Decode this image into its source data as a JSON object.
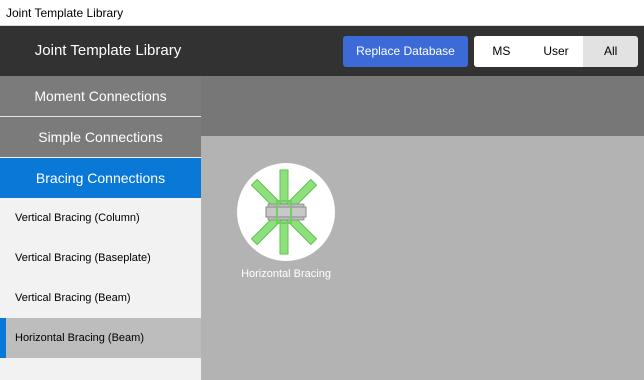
{
  "window": {
    "title": "Joint Template Library"
  },
  "header": {
    "title": "Joint Template Library",
    "replace_button": "Replace Database",
    "filters": [
      {
        "label": "MS",
        "active": false
      },
      {
        "label": "User",
        "active": false
      },
      {
        "label": "All",
        "active": true
      }
    ]
  },
  "sidebar": {
    "categories": [
      {
        "label": "Moment Connections",
        "active": false
      },
      {
        "label": "Simple Connections",
        "active": false
      },
      {
        "label": "Bracing Connections",
        "active": true
      }
    ],
    "items": [
      {
        "label": "Vertical Bracing (Column)",
        "selected": false
      },
      {
        "label": "Vertical Bracing (Baseplate)",
        "selected": false
      },
      {
        "label": "Vertical Bracing (Beam)",
        "selected": false
      },
      {
        "label": "Horizontal Bracing (Beam)",
        "selected": true
      }
    ]
  },
  "templates": [
    {
      "label": "Horizontal Bracing",
      "icon": "horizontal-bracing-icon"
    }
  ],
  "colors": {
    "header_bg": "#323232",
    "accent_blue": "#0a78d7",
    "button_blue": "#3c6bd8",
    "bracing_green": "#8ee07e"
  }
}
